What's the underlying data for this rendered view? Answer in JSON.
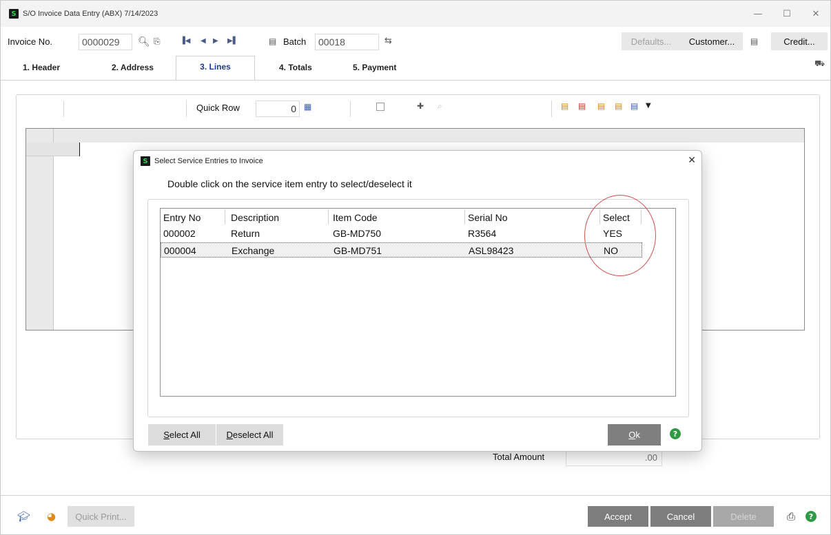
{
  "window": {
    "title": "S/O Invoice Data Entry (ABX) 7/14/2023",
    "minimize": "—",
    "maximize": "☐",
    "close": "✕"
  },
  "toolbar": {
    "invoice_label": "Invoice No.",
    "invoice_value": "0000029",
    "batch_label": "Batch",
    "batch_value": "00018",
    "defaults_label": "Defaults...",
    "customer_label": "Customer...",
    "credit_label": "Credit..."
  },
  "tabs": [
    {
      "label": "1. Header"
    },
    {
      "label": "2. Address"
    },
    {
      "label": "3. Lines"
    },
    {
      "label": "4. Totals"
    },
    {
      "label": "5. Payment"
    }
  ],
  "lines": {
    "quick_row_label": "Quick Row",
    "quick_row_value": "0"
  },
  "totals": {
    "total_amount_label": "Total Amount",
    "total_amount_value": ".00"
  },
  "footer": {
    "quick_print_label": "Quick Print...",
    "accept_label": "Accept",
    "cancel_label": "Cancel",
    "delete_label": "Delete"
  },
  "dialog": {
    "title": "Select Service Entries to Invoice",
    "instruction": "Double click on the service item entry to select/deselect it",
    "columns": [
      "Entry No",
      "Description",
      "Item Code",
      "Serial No",
      "Select"
    ],
    "rows": [
      {
        "entry_no": "000002",
        "description": "Return",
        "item_code": "GB-MD750",
        "serial_no": "R3564",
        "select": "YES"
      },
      {
        "entry_no": "000004",
        "description": "Exchange",
        "item_code": "GB-MD751",
        "serial_no": "ASL98423",
        "select": "NO"
      }
    ],
    "select_all_label": "Select All",
    "deselect_all_label": "Deselect All",
    "ok_label": "Ok"
  },
  "colors": {
    "accent_tab": "#1f3a93",
    "help_green": "#2e9a44",
    "annotation_red": "#d24b4b"
  }
}
